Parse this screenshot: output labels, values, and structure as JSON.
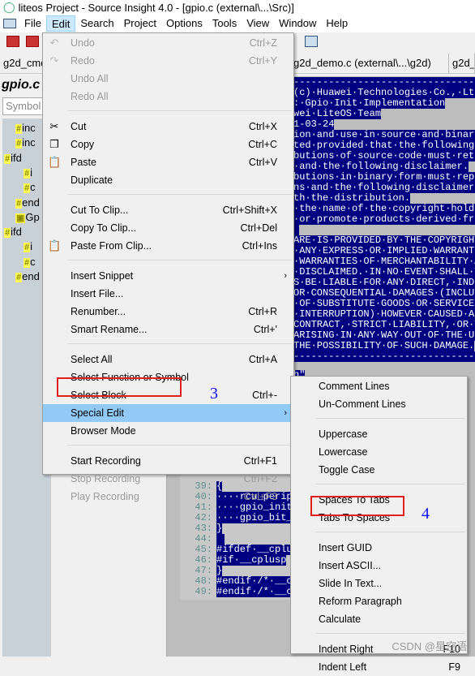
{
  "window": {
    "title": "liteos Project - Source Insight 4.0 - [gpio.c (external\\...\\Src)]"
  },
  "menubar": [
    "File",
    "Edit",
    "Search",
    "Project",
    "Options",
    "Tools",
    "View",
    "Window",
    "Help"
  ],
  "tabs": [
    "g2d_cmd",
    "g2d_demo.c (external\\...\\g2d)",
    "g2d_"
  ],
  "left_panel": {
    "file_title": "gpio.c",
    "symbol_placeholder": "Symbol",
    "tree": [
      "inc",
      "inc",
      "ifd",
      "i",
      "c",
      "end",
      "Gp",
      "ifd",
      "i",
      "c",
      "end"
    ]
  },
  "code_top": [
    "-----------------------------------",
    "(c)·Huawei·Technologies·Co.,·Ltd.",
    ":·Gpio·Init·Implementation",
    "wei·LiteOS·Team",
    "1-03-24",
    "ion·and·use·in·source·and·binary",
    "ted·provided·that·the·following·c",
    "butions·of·source·code·must·reta",
    "·and·the·following·disclaimer.",
    "butions·in·binary·form·must·repr",
    "ns·and·the·following·disclaimer·",
    "th·the·distribution.",
    "·the·name·of·the·copyright·holder",
    "·or·promote·products·derived·from",
    " ",
    "ARE·IS·PROVIDED·BY·THE·COPYRIGHT·",
    "·ANY·EXPRESS·OR·IMPLIED·WARRANTI",
    "·WARRANTIES·OF·MERCHANTABILITY·A",
    "·DISCLAIMED.·IN·NO·EVENT·SHALL·T",
    "S·BE·LIABLE·FOR·ANY·DIRECT,·INDI",
    "OR·CONSEQUENTIAL·DAMAGES·(INCLUD",
    "·OF·SUBSTITUTE·GOODS·OR·SERVICES",
    "·INTERRUPTION)·HOWEVER·CAUSED·AN",
    "CONTRACT,·STRICT·LIABILITY,·OR·T",
    "ARISING·IN·ANY·WAY·OUT·OF·THE·US",
    "THE·POSSIBILITY·OF·SUCH·DAMAGE.",
    "-----------------------------------"
  ],
  "code_include_fragment": "h\"",
  "code_bottom": [
    {
      "n": "39:",
      "t": "{"
    },
    {
      "n": "40:",
      "t": "····rcu_perip"
    },
    {
      "n": "41:",
      "t": "····gpio_init"
    },
    {
      "n": "42:",
      "t": "····gpio_bit_"
    },
    {
      "n": "43:",
      "t": "}"
    },
    {
      "n": "44:",
      "t": ""
    },
    {
      "n": "45:",
      "t": "#ifdef·__cplu"
    },
    {
      "n": "46:",
      "t": "#if·__cplusp"
    },
    {
      "n": "47:",
      "t": "}"
    },
    {
      "n": "48:",
      "t": "#endif·/*·__c"
    },
    {
      "n": "49:",
      "t": "#endif·/*·__c"
    }
  ],
  "edit_menu": [
    {
      "label": "Undo",
      "shortcut": "Ctrl+Z",
      "disabled": true,
      "icon": "undo-icon"
    },
    {
      "label": "Redo",
      "shortcut": "Ctrl+Y",
      "disabled": true,
      "icon": "redo-icon"
    },
    {
      "label": "Undo All",
      "shortcut": "",
      "disabled": true
    },
    {
      "label": "Redo All",
      "shortcut": "",
      "disabled": true,
      "sep_after": true
    },
    {
      "label": "Cut",
      "shortcut": "Ctrl+X",
      "icon": "scissors-icon"
    },
    {
      "label": "Copy",
      "shortcut": "Ctrl+C",
      "icon": "copy-icon"
    },
    {
      "label": "Paste",
      "shortcut": "Ctrl+V",
      "icon": "clipboard-icon"
    },
    {
      "label": "Duplicate",
      "shortcut": "",
      "sep_after": true
    },
    {
      "label": "Cut To Clip...",
      "shortcut": "Ctrl+Shift+X"
    },
    {
      "label": "Copy To Clip...",
      "shortcut": "Ctrl+Del"
    },
    {
      "label": "Paste From Clip...",
      "shortcut": "Ctrl+Ins",
      "icon": "clipboard-icon",
      "sep_after": true
    },
    {
      "label": "Insert Snippet",
      "shortcut": "",
      "submenu": true
    },
    {
      "label": "Insert File...",
      "shortcut": ""
    },
    {
      "label": "Renumber...",
      "shortcut": "Ctrl+R"
    },
    {
      "label": "Smart Rename...",
      "shortcut": "Ctrl+'",
      "sep_after": true
    },
    {
      "label": "Select All",
      "shortcut": "Ctrl+A"
    },
    {
      "label": "Select Function or Symbol",
      "shortcut": ""
    },
    {
      "label": "Select Block",
      "shortcut": "Ctrl+-"
    },
    {
      "label": "Special Edit",
      "shortcut": "",
      "submenu": true,
      "highlighted": true
    },
    {
      "label": "Browser Mode",
      "shortcut": "",
      "sep_after": true
    },
    {
      "label": "Start Recording",
      "shortcut": "Ctrl+F1"
    },
    {
      "label": "Stop Recording",
      "shortcut": "Ctrl+F2",
      "disabled": true
    },
    {
      "label": "Play Recording",
      "shortcut": "Ctrl+F3",
      "disabled": true
    }
  ],
  "special_edit_menu": [
    {
      "label": "Comment Lines",
      "shortcut": ""
    },
    {
      "label": "Un-Comment Lines",
      "shortcut": "",
      "sep_after": true
    },
    {
      "label": "Uppercase",
      "shortcut": ""
    },
    {
      "label": "Lowercase",
      "shortcut": ""
    },
    {
      "label": "Toggle Case",
      "shortcut": "",
      "sep_after": true
    },
    {
      "label": "Spaces To Tabs",
      "shortcut": ""
    },
    {
      "label": "Tabs To Spaces",
      "shortcut": "",
      "boxed": true,
      "sep_after": true
    },
    {
      "label": "Insert GUID",
      "shortcut": ""
    },
    {
      "label": "Insert ASCII...",
      "shortcut": ""
    },
    {
      "label": "Slide In Text...",
      "shortcut": ""
    },
    {
      "label": "Reform Paragraph",
      "shortcut": ""
    },
    {
      "label": "Calculate",
      "shortcut": "",
      "sep_after": true
    },
    {
      "label": "Indent Right",
      "shortcut": "F10"
    },
    {
      "label": "Indent Left",
      "shortcut": "F9"
    }
  ],
  "annotations": {
    "step3": "3",
    "step4": "4"
  },
  "watermark": "CSDN @星空语",
  "colors": {
    "selection": "#000080",
    "menu_highlight": "#91c9f7",
    "annotation_box": "#e02020",
    "annotation_text": "#1010ff"
  }
}
